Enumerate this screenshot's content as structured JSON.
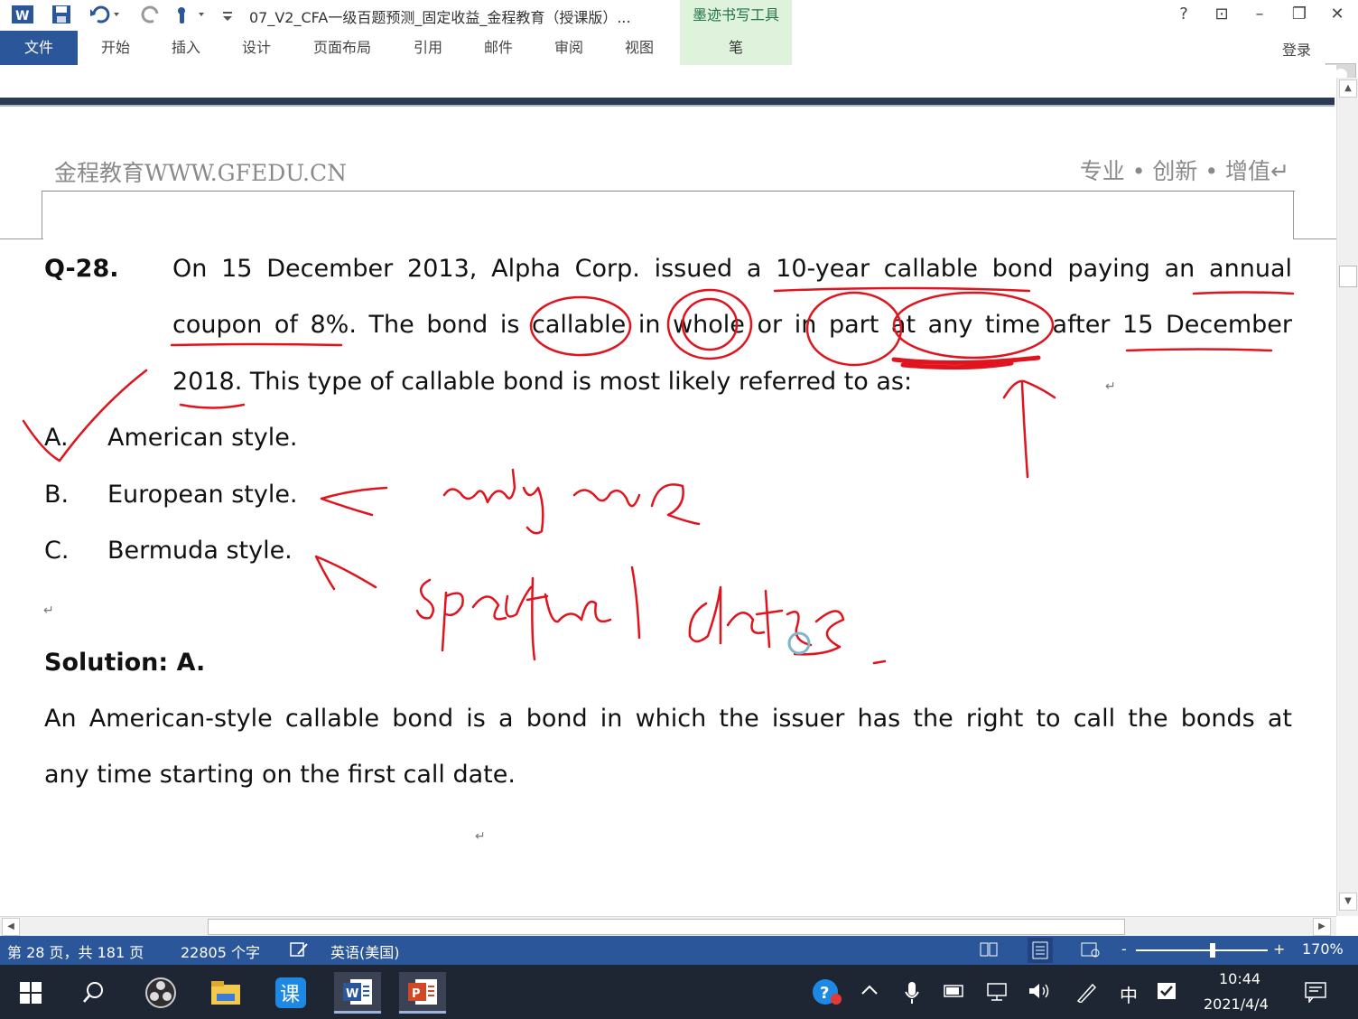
{
  "window": {
    "doc_title": "07_V2_CFA一级百题预测_固定收益_金程教育（授课版）...",
    "ink_tools_title": "墨迹书写工具",
    "help": "?",
    "restore_ribbon": "⊡",
    "minimize": "–",
    "maximize": "❐",
    "close": "✕",
    "login": "登录"
  },
  "ribbon": {
    "tabs": [
      "文件",
      "开始",
      "插入",
      "设计",
      "页面布局",
      "引用",
      "邮件",
      "审阅",
      "视图",
      "笔"
    ]
  },
  "header": {
    "left": "金程教育WWW.GFEDU.CN",
    "right": "专业 • 创新 • 增值↵"
  },
  "question": {
    "number": "Q-28.",
    "line1": "On 15 December 2013, Alpha Corp. issued a 10-year callable bond paying an annual",
    "line2": "coupon of 8%. The bond is callable in whole or in part at any time after 15 December",
    "line3": "2018. This type of callable bond is most likely referred to as:",
    "options": [
      {
        "letter": "A.",
        "text": "American style."
      },
      {
        "letter": "B.",
        "text": "European style."
      },
      {
        "letter": "C.",
        "text": "Bermuda style."
      }
    ]
  },
  "solution": {
    "title": "Solution: A.",
    "line1": "An American-style callable bond is a bond in which the issuer has the right to call the bonds at",
    "line2": "any time starting on the first call date."
  },
  "marks": {
    "para": "↵"
  },
  "statusbar": {
    "page": "第 28 页，共 181 页",
    "words": "22805 个字",
    "language": "英语(美国)",
    "zoom": "170%",
    "zoom_minus": "-",
    "zoom_plus": "+"
  },
  "taskbar": {
    "ime": "中",
    "time": "10:44",
    "date": "2021/4/4"
  },
  "colors": {
    "word_blue": "#2b579a",
    "ink_red": "#e0141e",
    "ink_tab_green": "#dff2dc"
  }
}
